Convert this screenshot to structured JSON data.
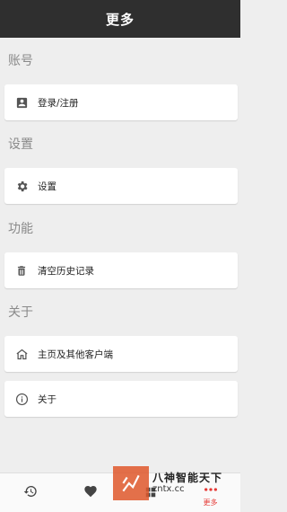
{
  "app_bar": {
    "title": "更多"
  },
  "sections": {
    "account": {
      "title": "账号",
      "login_label": "登录/注册"
    },
    "settings": {
      "title": "设置",
      "settings_label": "设置"
    },
    "features": {
      "title": "功能",
      "clear_history_label": "清空历史记录"
    },
    "about": {
      "title": "关于",
      "homepage_label": "主页及其他客户端",
      "about_label": "关于"
    }
  },
  "bottom_nav": {
    "items": [
      {
        "icon": "history-icon"
      },
      {
        "icon": "heart-icon"
      },
      {
        "icon": "grid-icon"
      },
      {
        "icon": "more-icon",
        "label": "更多",
        "active": true
      }
    ],
    "active_color": "#e53935"
  },
  "watermark": {
    "line1": "八神智能天下",
    "line2": "zntx.cc"
  },
  "colors": {
    "app_bar": "#2f2f2f",
    "background": "#eeeeee",
    "section_title": "#8a8a8a",
    "icon": "#555555"
  }
}
